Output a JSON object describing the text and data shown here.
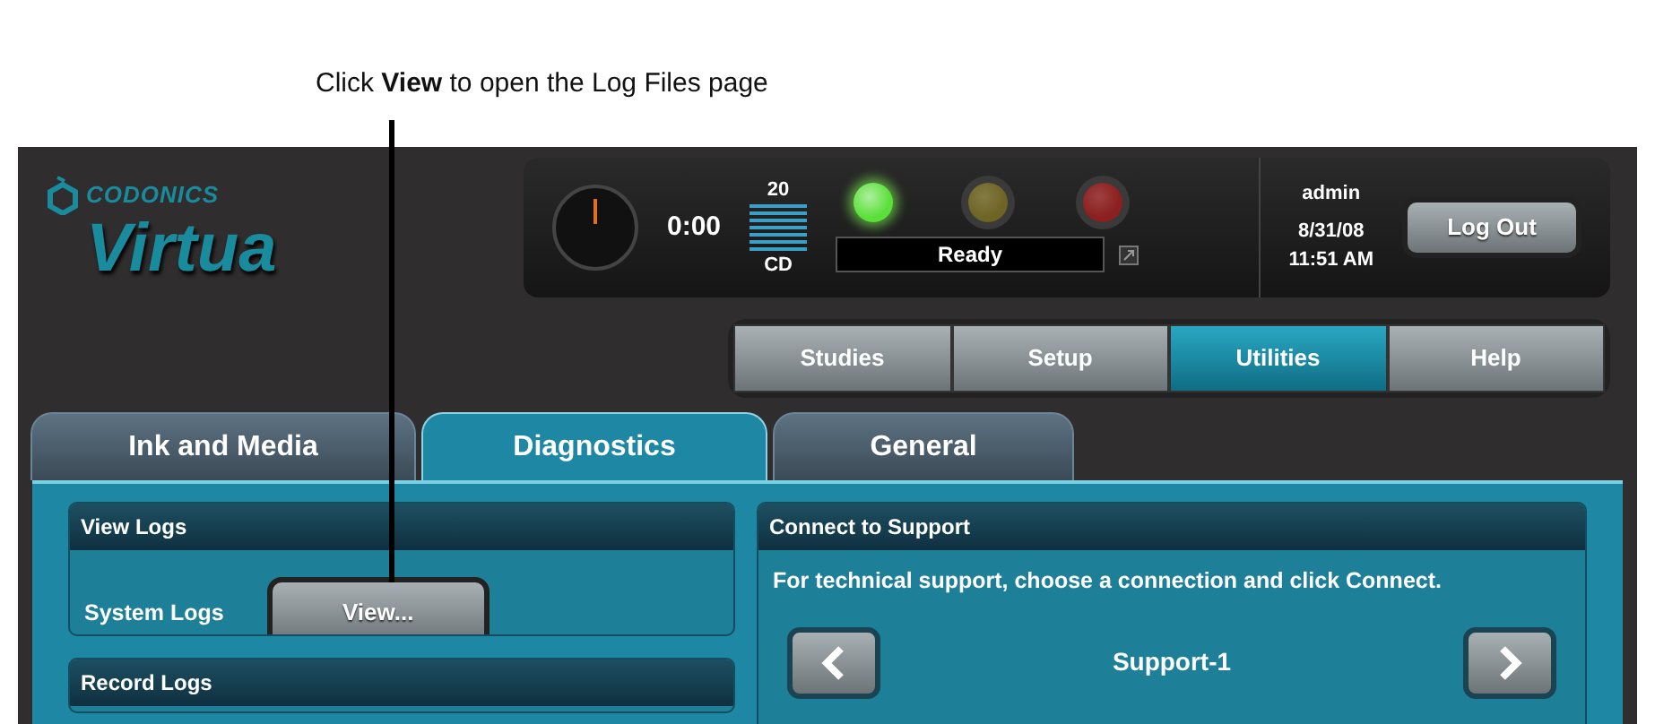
{
  "annotation": {
    "text": "Click **View** to open the Log Files page"
  },
  "logo": {
    "brand": "CODONICS",
    "product": "Virtua"
  },
  "status_panel": {
    "timer": "0:00",
    "disc_count": "20",
    "disc_type": "CD",
    "lights": [
      {
        "color": "#5be03a",
        "on": true
      },
      {
        "color": "#6e6424",
        "on": false
      },
      {
        "color": "#8c1f1f",
        "on": false
      }
    ],
    "status": "Ready",
    "user": "admin",
    "date": "8/31/08",
    "time": "11:51 AM",
    "logout_button": "Log Out"
  },
  "nav": [
    {
      "label": "Studies",
      "selected": false
    },
    {
      "label": "Setup",
      "selected": false
    },
    {
      "label": "Utilities",
      "selected": true
    },
    {
      "label": "Help",
      "selected": false
    }
  ],
  "tabs": [
    {
      "label": "Ink and Media",
      "selected": false
    },
    {
      "label": "Diagnostics",
      "selected": true
    },
    {
      "label": "General",
      "selected": false
    }
  ],
  "view_logs": {
    "title": "View Logs",
    "label": "System Logs",
    "button": "View..."
  },
  "record_logs": {
    "title": "Record Logs"
  },
  "connect": {
    "title": "Connect to Support",
    "text": "For technical support, choose a connection and click Connect.",
    "connection": "Support-1"
  }
}
